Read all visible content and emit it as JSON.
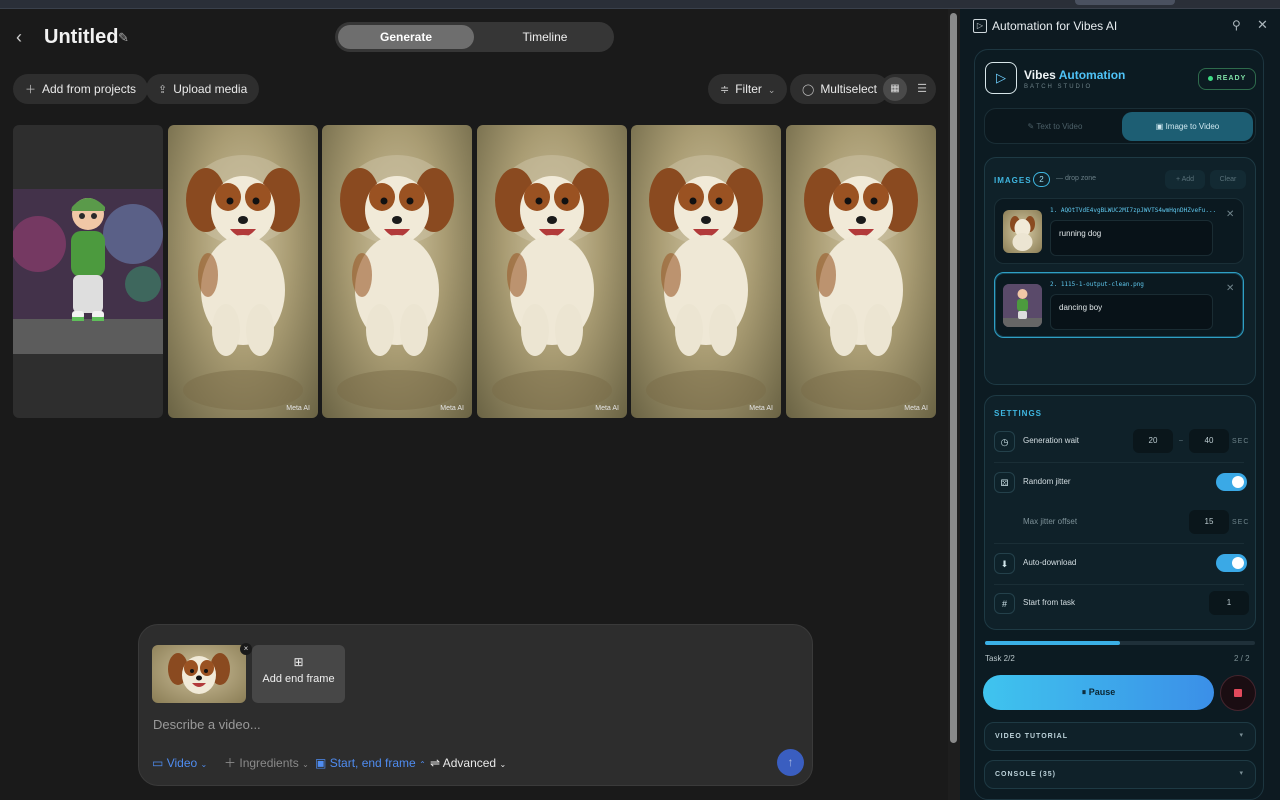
{
  "header": {
    "title": "Untitled",
    "tabs": [
      "Generate",
      "Timeline"
    ]
  },
  "toolbar": {
    "add_from_projects": "Add from projects",
    "upload_media": "Upload media",
    "filter": "Filter",
    "multiselect": "Multiselect"
  },
  "gallery": {
    "watermark": "Meta AI"
  },
  "composer": {
    "end_frame_label": "Add end frame",
    "placeholder": "Describe a video...",
    "options": {
      "video": "Video",
      "ingredients": "Ingredients",
      "frames": "Start, end frame",
      "advanced": "Advanced"
    }
  },
  "panel": {
    "window_title": "Automation for Vibes AI",
    "brand_a": "Vibes",
    "brand_b": "Automation",
    "brand_sub": "BATCH STUDIO",
    "status": "READY",
    "tabs": [
      "Text to Video",
      "Image to Video"
    ],
    "images": {
      "label": "IMAGES",
      "count": "2",
      "drop_zone": "— drop zone",
      "add": "+ Add",
      "clear": "Clear",
      "items": [
        {
          "file": "1. AQOtTVdE4vgBLWUC2MI7zpJWVTS4wmHqnDHZveFu...",
          "prompt": "running dog"
        },
        {
          "file": "2. 1115-1-output-clean.png",
          "prompt": "dancing boy"
        }
      ]
    },
    "settings": {
      "label": "SETTINGS",
      "generation_wait": "Generation wait",
      "wait_min": "20",
      "wait_sep": "–",
      "wait_max": "40",
      "unit_sec": "SEC",
      "random_jitter": "Random jitter",
      "max_jitter": "Max jitter offset",
      "max_jitter_val": "15",
      "auto_download": "Auto-download",
      "start_from_task": "Start from task",
      "start_task_val": "1"
    },
    "progress": {
      "fraction": 0.5,
      "task_label": "Task 2/2",
      "task_count": "2 / 2"
    },
    "pause": "Pause",
    "video_tutorial": "VIDEO TUTORIAL",
    "console": "CONSOLE (35)"
  },
  "colors": {
    "accent": "#3fb6e0",
    "toggle_on": "#3aa9e6",
    "ready_green": "#3ddc84",
    "stop_red": "#e24a5c",
    "composer_blue": "#4f8cf0"
  }
}
